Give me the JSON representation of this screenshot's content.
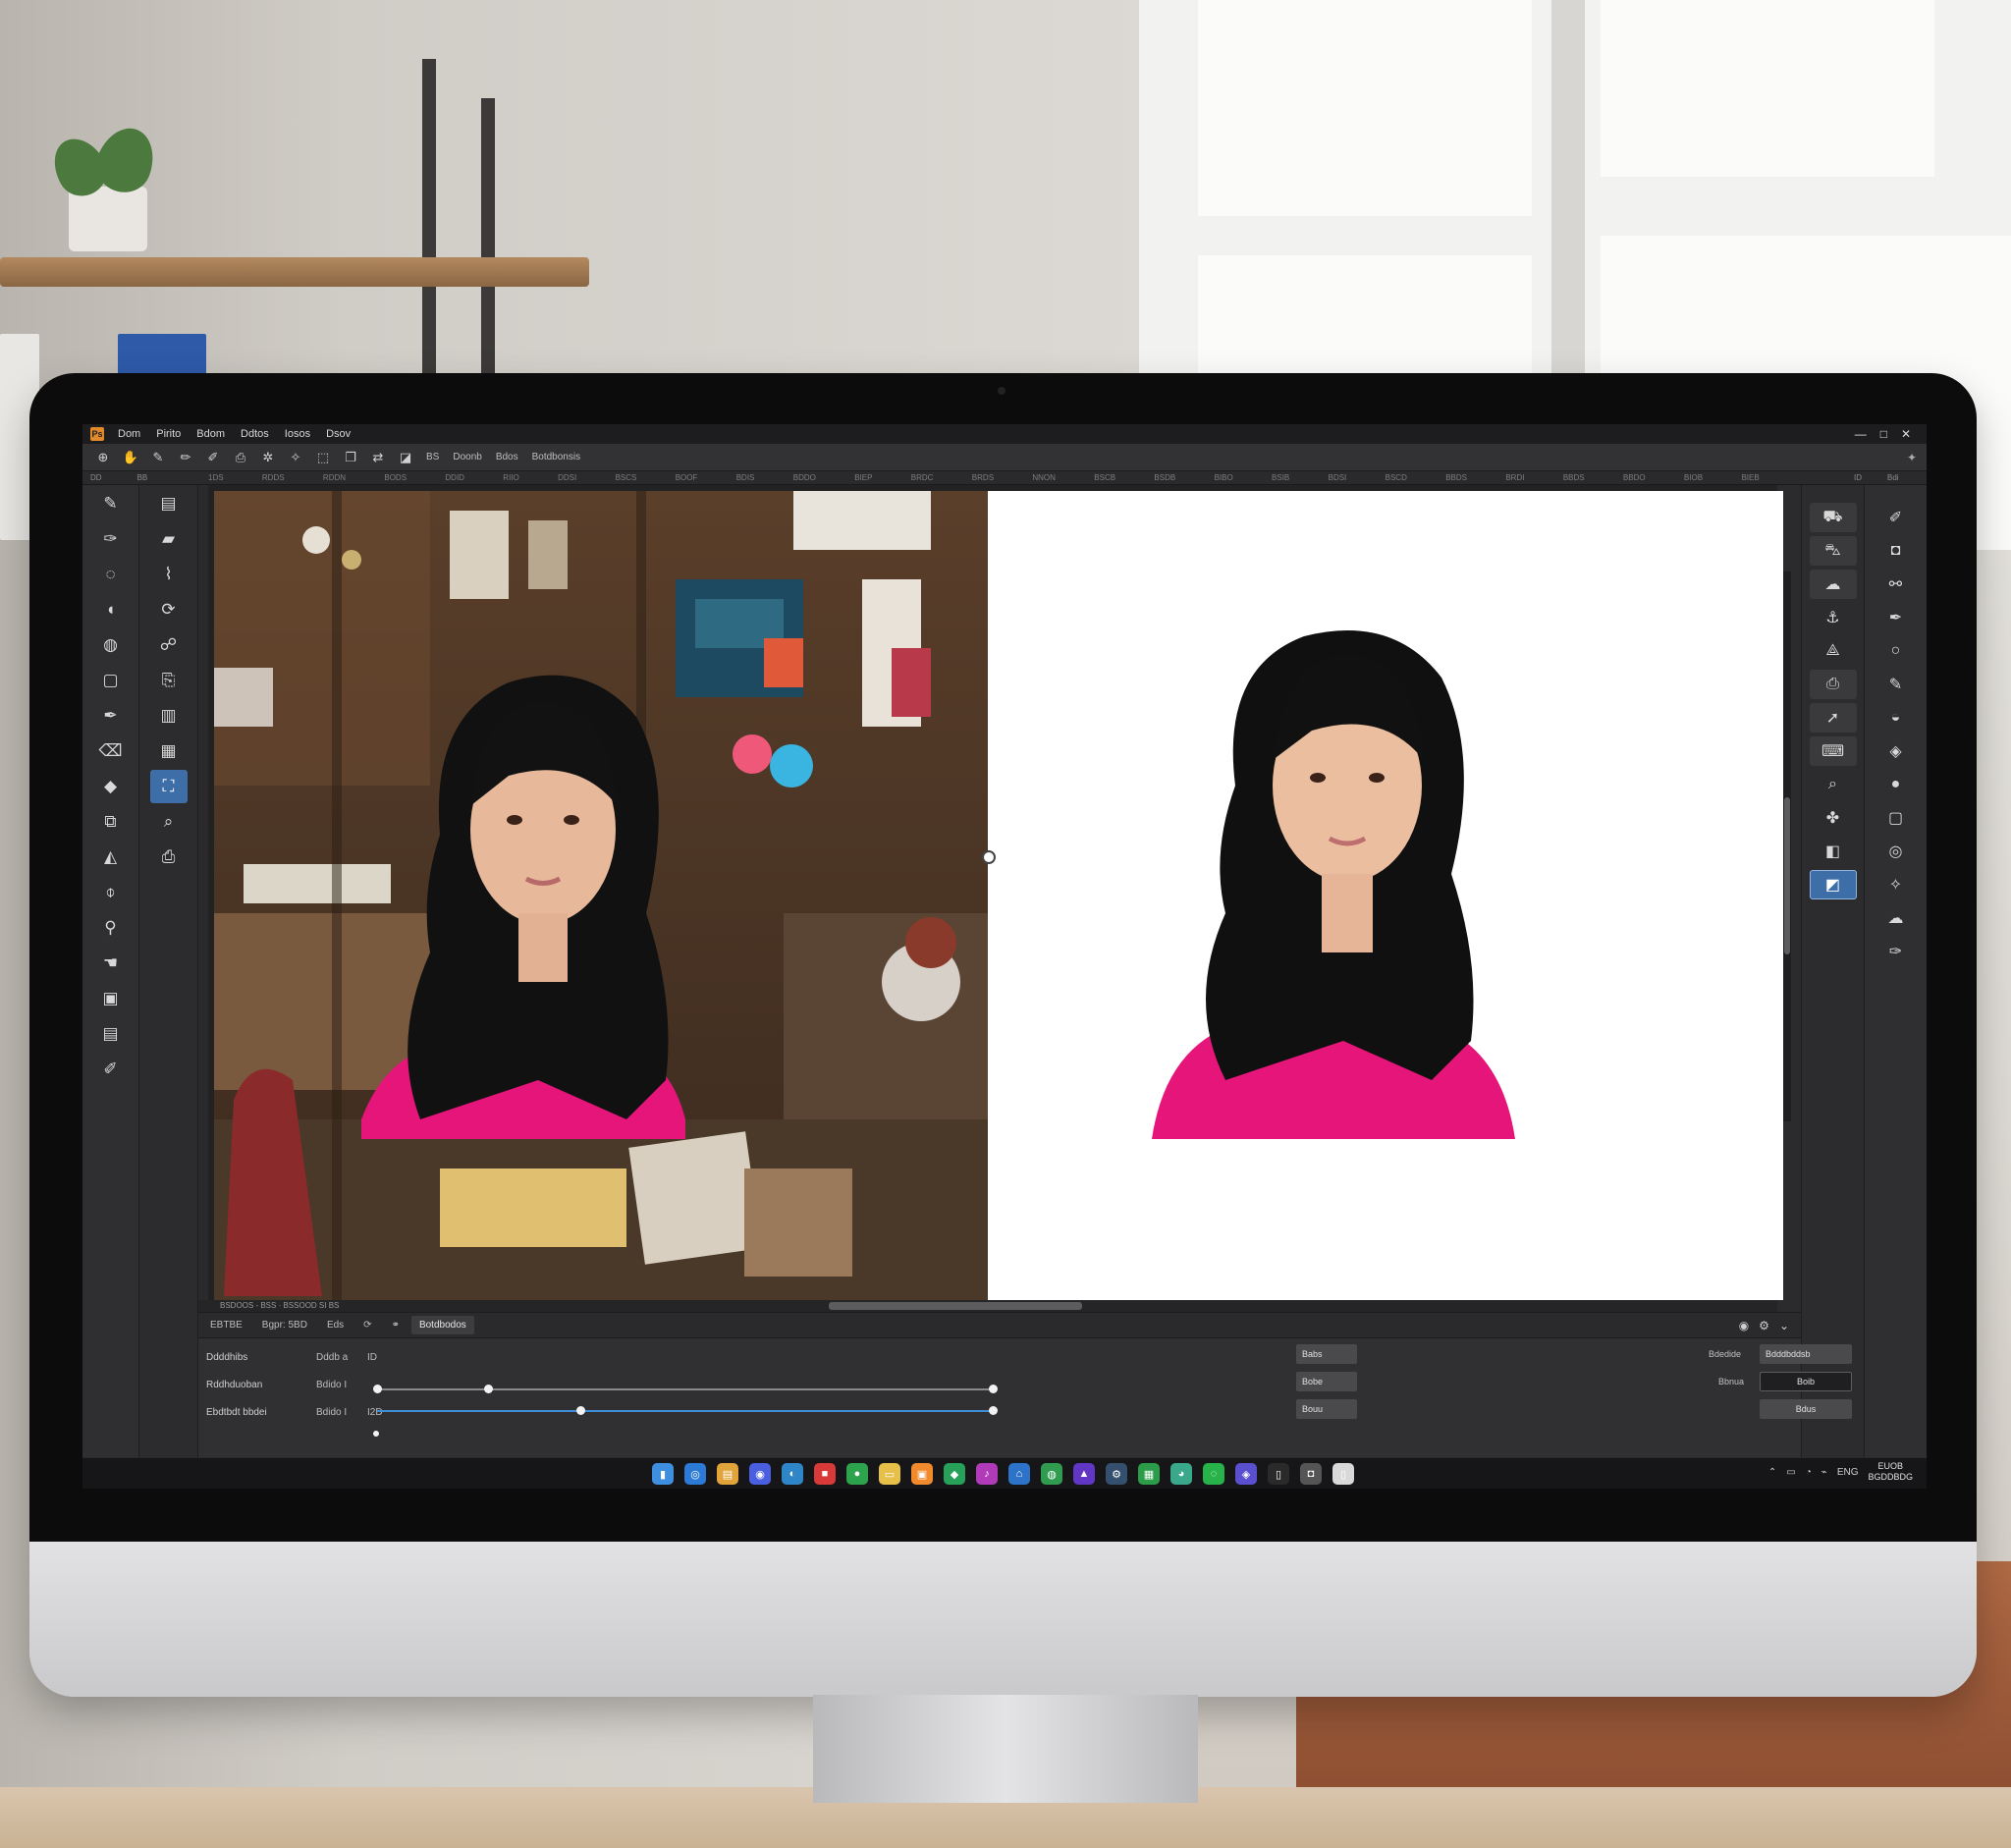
{
  "window": {
    "menu": [
      "Dom",
      "Pirito",
      "Bdom",
      "Ddtos",
      "Iosos",
      "Dsov"
    ],
    "controls": [
      "—",
      "□",
      "✕"
    ]
  },
  "options_bar": {
    "texts": [
      "BS",
      "Doonb",
      "Bdos",
      "Botdbonsis"
    ]
  },
  "ruler": {
    "left_labels": [
      "DD",
      "BB"
    ],
    "ticks": [
      "1DS",
      "RDDS",
      "RDDN",
      "BODS",
      "DDID",
      "RIIO",
      "DDSI",
      "BSCS",
      "BOOF",
      "BDIS",
      "BDDO",
      "BIEP",
      "BRDC",
      "BRDS",
      "NNON",
      "BSCB",
      "BSDB",
      "BIBO",
      "BSIB",
      "BDSI",
      "BSCD",
      "BBDS",
      "BRDI",
      "BBDS",
      "BBDO",
      "BIOB",
      "BIEB"
    ],
    "right_labels": [
      "ID",
      "Bdi"
    ]
  },
  "canvas": {
    "status": "BSDOOS - BSS · BSSOOD SI BS"
  },
  "bottom_panel": {
    "tabs": [
      "EBTBE",
      "Bgpr: 5BD",
      "Eds",
      "Botdbodos"
    ],
    "rows": [
      {
        "label": "Ddddhibs",
        "value": "Dddb a",
        "extra": "ID",
        "slider": 0.18,
        "button": "Babs"
      },
      {
        "label": "Rddhduoban",
        "value": "Bdido I",
        "extra": "",
        "slider": 0.33,
        "button": "Bobe"
      },
      {
        "label": "Ebdtbdt bbdei",
        "value": "Bdido I",
        "extra": "I2D",
        "slider": 1.0,
        "button": "Bouu"
      }
    ],
    "right_fields": [
      {
        "label": "Bdedide",
        "value": "Bdddbddsb"
      },
      {
        "label": "Bbnua",
        "value": "Boib"
      },
      {
        "label": "",
        "value": "Bdus"
      }
    ]
  },
  "taskbar": {
    "icons": [
      {
        "name": "files-app-icon",
        "color": "#3f8fe0",
        "glyph": "▮"
      },
      {
        "name": "browser-icon",
        "color": "#2b7bd6",
        "glyph": "◎"
      },
      {
        "name": "folder-icon",
        "color": "#e0a43a",
        "glyph": "▤"
      },
      {
        "name": "messages-icon",
        "color": "#4a5ee0",
        "glyph": "◉"
      },
      {
        "name": "edge-icon",
        "color": "#2e86c8",
        "glyph": "◐"
      },
      {
        "name": "media-icon",
        "color": "#d83a3a",
        "glyph": "■"
      },
      {
        "name": "chat-icon",
        "color": "#2ea34d",
        "glyph": "●"
      },
      {
        "name": "notes-icon",
        "color": "#e7c04a",
        "glyph": "▭"
      },
      {
        "name": "docs-icon",
        "color": "#f08a2c",
        "glyph": "▣"
      },
      {
        "name": "phone-icon",
        "color": "#27a05a",
        "glyph": "◆"
      },
      {
        "name": "music-icon",
        "color": "#b03ab8",
        "glyph": "♪"
      },
      {
        "name": "store-icon",
        "color": "#2c73c9",
        "glyph": "⌂"
      },
      {
        "name": "chrome-icon",
        "color": "#2f9c50",
        "glyph": "◍"
      },
      {
        "name": "photos-icon",
        "color": "#6236c4",
        "glyph": "▲"
      },
      {
        "name": "settings-icon",
        "color": "#34506e",
        "glyph": "⚙"
      },
      {
        "name": "sheets-icon",
        "color": "#2b9c4a",
        "glyph": "▦"
      },
      {
        "name": "maps-icon",
        "color": "#3aa88a",
        "glyph": "◕"
      },
      {
        "name": "whatsapp-icon",
        "color": "#27b34a",
        "glyph": "◌"
      },
      {
        "name": "teams-icon",
        "color": "#5a4fcf",
        "glyph": "◈"
      },
      {
        "name": "terminal-icon",
        "color": "#2a2a2a",
        "glyph": "▯"
      },
      {
        "name": "camera-icon",
        "color": "#555555",
        "glyph": "◘"
      },
      {
        "name": "bin-icon",
        "color": "#d9d9d9",
        "glyph": "▯"
      }
    ],
    "tray": [
      "⌃",
      "▭",
      "◔",
      "⌁",
      "ENG"
    ],
    "clock": [
      "EUOB",
      "BGDDBDG"
    ]
  },
  "colors": {
    "accent": "#3e6ea8",
    "shirt": "#e5157a"
  }
}
